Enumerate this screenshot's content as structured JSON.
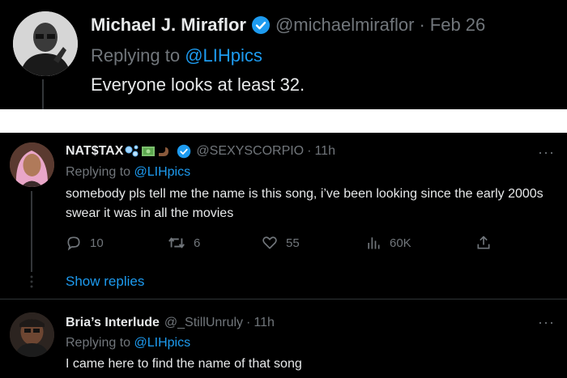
{
  "top_tweet": {
    "display_name": "Michael J. Miraflor",
    "handle": "@michaelmiraflor",
    "separator": "·",
    "date": "Feb 26",
    "replying_prefix": "Replying to",
    "replying_handle": "@LIHpics",
    "text": "Everyone looks at least 32.",
    "verified": true
  },
  "reply_1": {
    "display_name": "NAT$TAX",
    "handle": "@SEXYSCORPIO",
    "separator": "·",
    "time": "11h",
    "replying_prefix": "Replying to",
    "replying_handle": "@LIHpics",
    "text": "somebody pls tell me the name is this song, i’ve been looking since the early 2000s swear it was in all the movies",
    "verified": true,
    "name_emojis": [
      "bubbles-emoji",
      "money-emoji",
      "flexed-arm-emoji"
    ],
    "more_label": "···",
    "actions": {
      "replies": "10",
      "retweets": "6",
      "likes": "55",
      "views": "60K"
    },
    "show_replies_label": "Show replies"
  },
  "reply_2": {
    "display_name": "Bria’s Interlude",
    "handle": "@_StillUnruly",
    "separator": "·",
    "time": "11h",
    "replying_prefix": "Replying to",
    "replying_handle": "@LIHpics",
    "text": "I came here to find the name of that song",
    "more_label": "···"
  },
  "colors": {
    "background": "#000000",
    "text": "#e7e9ea",
    "muted": "#71767b",
    "accent": "#1d9bf0"
  }
}
